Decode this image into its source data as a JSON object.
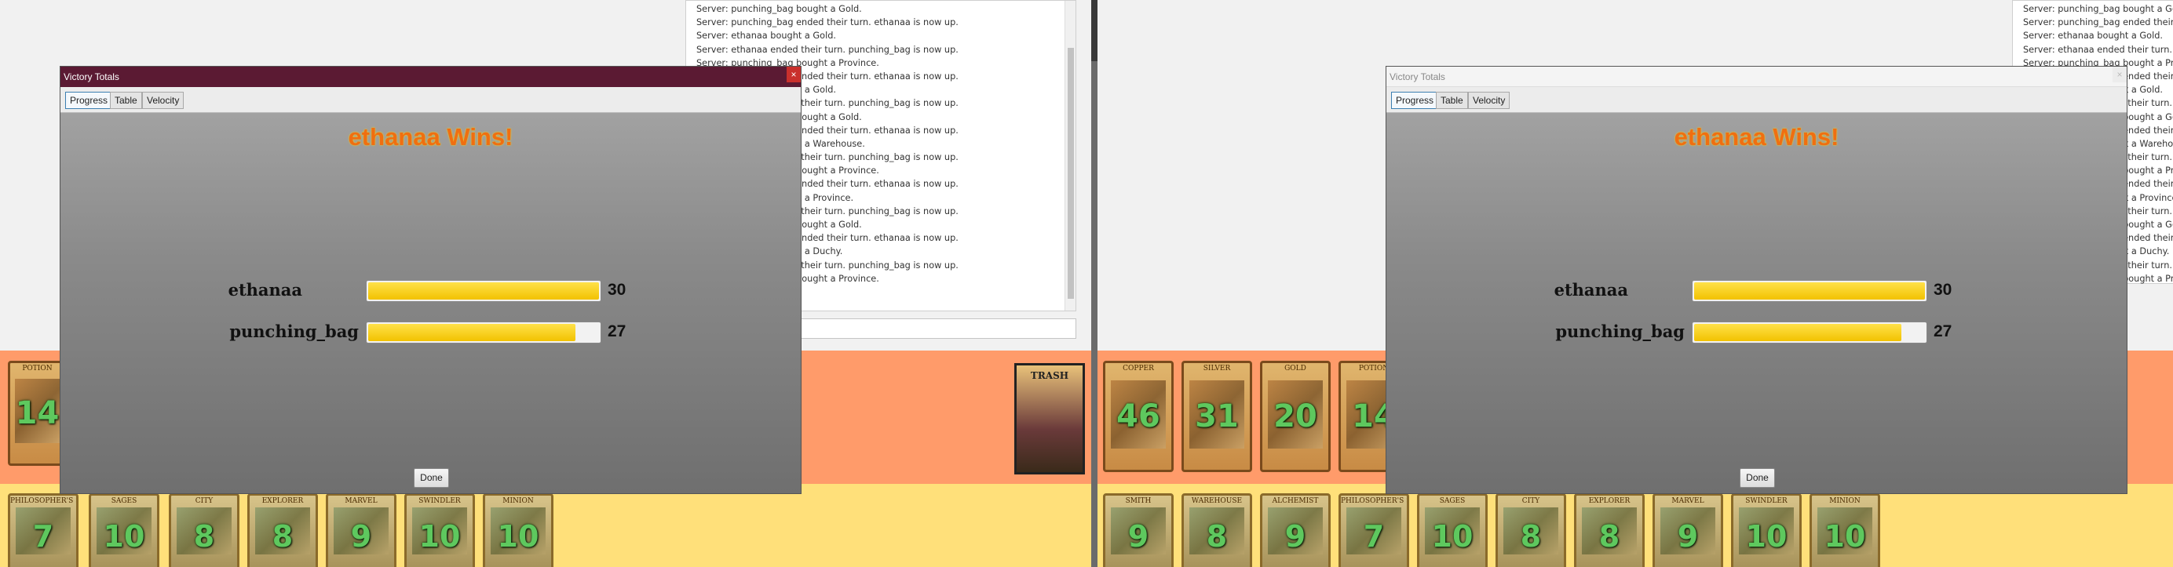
{
  "log_lines": [
    "Server: punching_bag bought a Gold.",
    "Server: punching_bag ended their turn. ethanaa is now up.",
    "Server: ethanaa bought a Gold.",
    "Server: ethanaa ended their turn. punching_bag is now up.",
    "Server: punching_bag bought a Province.",
    "Server: punching_bag ended their turn. ethanaa is now up.",
    "Server: ethanaa bought a Gold.",
    "Server: ethanaa ended their turn. punching_bag is now up.",
    "Server: punching_bag bought a Gold.",
    "Server: punching_bag ended their turn. ethanaa is now up.",
    "Server: ethanaa bought a Warehouse.",
    "Server: ethanaa ended their turn. punching_bag is now up.",
    "Server: punching_bag bought a Province.",
    "Server: punching_bag ended their turn. ethanaa is now up.",
    "Server: ethanaa bought a Province.",
    "Server: ethanaa ended their turn. punching_bag is now up.",
    "Server: punching_bag bought a Gold.",
    "Server: punching_bag ended their turn. ethanaa is now up.",
    "Server: ethanaa bought a Duchy.",
    "Server: ethanaa ended their turn. punching_bag is now up.",
    "Server: punching_bag bought a Province."
  ],
  "dialog": {
    "title": "Victory Totals",
    "close": "×",
    "tabs": [
      "Progress",
      "Table",
      "Velocity"
    ],
    "winner_text": "ethanaa Wins!",
    "done_label": "Done",
    "players": [
      {
        "name": "ethanaa",
        "score": "30",
        "progress": 1.0
      },
      {
        "name": "punching_bag",
        "score": "27",
        "progress": 0.9
      }
    ]
  },
  "trash_label": "TRASH",
  "left_supply": [
    {
      "name": "POTION",
      "count": "14"
    }
  ],
  "right_supply": [
    {
      "name": "COPPER",
      "count": "46"
    },
    {
      "name": "SILVER",
      "count": "31"
    },
    {
      "name": "GOLD",
      "count": "20"
    },
    {
      "name": "POTION",
      "count": "14"
    }
  ],
  "left_kingdom": [
    {
      "name": "PHILOSOPHER'S STONE",
      "count": "7"
    },
    {
      "name": "SAGES",
      "count": "10"
    },
    {
      "name": "CITY",
      "count": "8"
    },
    {
      "name": "EXPLORER",
      "count": "8"
    },
    {
      "name": "MARVEL",
      "count": "9"
    },
    {
      "name": "SWINDLER",
      "count": "10"
    },
    {
      "name": "MINION",
      "count": "10"
    }
  ],
  "right_kingdom": [
    {
      "name": "SMITH",
      "count": "9"
    },
    {
      "name": "WAREHOUSE",
      "count": "8"
    },
    {
      "name": "ALCHEMIST",
      "count": "9"
    },
    {
      "name": "PHILOSOPHER'S STONE",
      "count": "7"
    },
    {
      "name": "SAGES",
      "count": "10"
    },
    {
      "name": "CITY",
      "count": "8"
    },
    {
      "name": "EXPLORER",
      "count": "8"
    },
    {
      "name": "MARVEL",
      "count": "9"
    },
    {
      "name": "SWINDLER",
      "count": "10"
    },
    {
      "name": "MINION",
      "count": "10"
    }
  ],
  "colors": {
    "title_active": "#5b1a33",
    "winner": "#f06e11",
    "bar_fill": "#f2c200",
    "supply_bg": "#ff9b6a",
    "kingdom_bg": "#ffe07a",
    "count_text": "#5ec85e"
  }
}
